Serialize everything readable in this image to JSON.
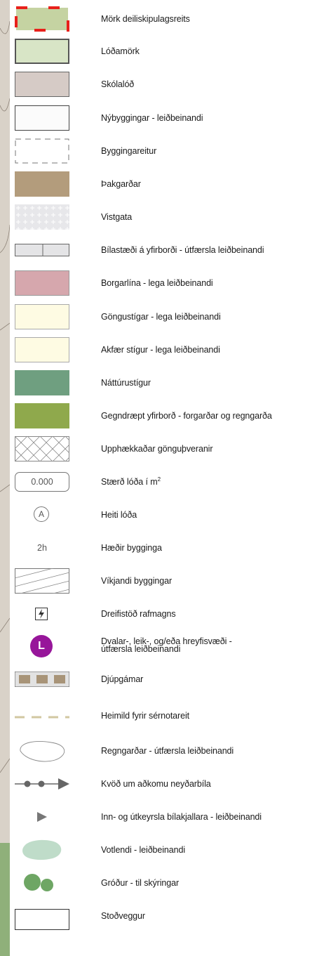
{
  "legend": {
    "items": [
      {
        "label": "Mörk deiliskipulagsreits",
        "icon": "plan-boundary-swatch"
      },
      {
        "label": "Lóðamörk",
        "icon": "lot-boundary-swatch"
      },
      {
        "label": "Skólalóð",
        "icon": "school-lot-swatch"
      },
      {
        "label": "Nýbyggingar - leiðbeinandi",
        "icon": "new-building-swatch"
      },
      {
        "label": "Byggingareitur",
        "icon": "building-plot-dashed-swatch"
      },
      {
        "label": "Þakgarðar",
        "icon": "roof-garden-swatch"
      },
      {
        "label": "Vistgata",
        "icon": "living-street-swatch"
      },
      {
        "label": "Bílastæði á yfirborði - útfærsla leiðbeinandi",
        "icon": "surface-parking-swatch"
      },
      {
        "label": "Borgarlína - lega leiðbeinandi",
        "icon": "brt-line-swatch"
      },
      {
        "label": "Göngustígar - lega leiðbeinandi",
        "icon": "footpath-swatch"
      },
      {
        "label": "Akfær stígur - lega leiðbeinandi",
        "icon": "drivable-path-swatch"
      },
      {
        "label": "Náttúrustígur",
        "icon": "nature-path-swatch"
      },
      {
        "label": "Gegndræpt yfirborð - forgarðar og regngarða",
        "icon": "permeable-surface-swatch"
      },
      {
        "label": "Upphækkaðar gönguþveranir",
        "icon": "raised-crossing-swatch"
      },
      {
        "label_main": "Stærð lóða í m",
        "label_sup": "2",
        "value": "0.000",
        "icon": "lot-size-box"
      },
      {
        "label": "Heiti lóða",
        "value": "A",
        "icon": "lot-name-circle-icon"
      },
      {
        "label": "Hæðir bygginga",
        "value": "2h",
        "icon": "storeys-text"
      },
      {
        "label": "Víkjandi byggingar",
        "icon": "demolished-building-hatch-swatch"
      },
      {
        "label": "Dreifistöð rafmagns",
        "icon": "substation-icon"
      },
      {
        "label_line1": "Dvalar-, leik-, og/eða hreyfisvæði -",
        "label_line2": "útfærsla leiðbeinandi",
        "value": "L",
        "icon": "play-area-icon"
      },
      {
        "label": "Djúpgámar",
        "icon": "deep-container-icon"
      },
      {
        "label": "Heimild fyrir sérnotareit",
        "icon": "private-use-dashed-line-icon"
      },
      {
        "label": "Regngarðar - útfærsla leiðbeinandi",
        "icon": "rain-garden-oval-icon"
      },
      {
        "label": "Kvöð um aðkomu neyðarbíla",
        "icon": "emergency-access-arrow-icon"
      },
      {
        "label": "Inn- og útkeyrsla bílakjallara - leiðbeinandi",
        "icon": "garage-entrance-triangle-icon"
      },
      {
        "label": "Votlendi - leiðbeinandi",
        "icon": "wetland-blob-icon"
      },
      {
        "label": "Gróður - til skýringar",
        "icon": "vegetation-circles-icon"
      },
      {
        "label": "Stoðveggur",
        "icon": "retaining-wall-swatch"
      }
    ]
  },
  "colors": {
    "plan_boundary_fill": "#c5d3a2",
    "plan_boundary_dash": "#e8201b",
    "lot_fill": "#d8e5c6",
    "school_fill": "#d6cbc6",
    "roof_garden": "#b39c7c",
    "living_street": "#e7e7ea",
    "brt": "#d6a7ad",
    "footpath": "#fefbe3",
    "nature_path": "#6f9f80",
    "permeable": "#8fa94c",
    "play_area": "#97169a",
    "wetland": "#bfdcc9",
    "vegetation": "#6ea664",
    "private_use_dash": "#d1c7a1"
  }
}
